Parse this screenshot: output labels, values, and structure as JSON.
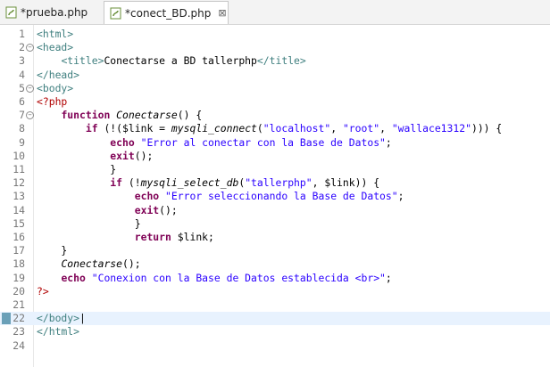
{
  "tabs": [
    {
      "label": "*prueba.php",
      "active": false
    },
    {
      "label": "*conect_BD.php",
      "active": true,
      "close": "⊠"
    }
  ],
  "lines": [
    {
      "n": "1",
      "fold": "",
      "html": "<span class='tag'>&lt;html&gt;</span>"
    },
    {
      "n": "2",
      "fold": "⊖",
      "html": "<span class='tag'>&lt;head&gt;</span>"
    },
    {
      "n": "3",
      "fold": "",
      "html": "    <span class='tag'>&lt;title&gt;</span>Conectarse a BD tallerphp<span class='tag'>&lt;/title&gt;</span>"
    },
    {
      "n": "4",
      "fold": "",
      "html": "<span class='tag'>&lt;/head&gt;</span>"
    },
    {
      "n": "5",
      "fold": "⊖",
      "html": "<span class='tag'>&lt;body&gt;</span>"
    },
    {
      "n": "6",
      "fold": "",
      "html": "<span class='php'>&lt;?php</span>"
    },
    {
      "n": "7",
      "fold": "⊖",
      "html": "    <span class='kw'>function</span> <span class='fn'>Conectarse</span>() {"
    },
    {
      "n": "8",
      "fold": "",
      "html": "        <span class='kw'>if</span> (!(<span class='var'>$link</span> = <span class='fn'>mysqli_connect</span>(<span class='str'>\"localhost\"</span>, <span class='str'>\"root\"</span>, <span class='str'>\"wallace1312\"</span>))) {"
    },
    {
      "n": "9",
      "fold": "",
      "html": "            <span class='kw'>echo</span> <span class='str'>\"Error al conectar con la Base de Datos\"</span>;"
    },
    {
      "n": "10",
      "fold": "",
      "html": "            <span class='kw'>exit</span>();"
    },
    {
      "n": "11",
      "fold": "",
      "html": "            }"
    },
    {
      "n": "12",
      "fold": "",
      "html": "            <span class='kw'>if</span> (!<span class='fn'>mysqli_select_db</span>(<span class='str'>\"tallerphp\"</span>, <span class='var'>$link</span>)) {"
    },
    {
      "n": "13",
      "fold": "",
      "html": "                <span class='kw'>echo</span> <span class='str'>\"Error seleccionando la Base de Datos\"</span>;"
    },
    {
      "n": "14",
      "fold": "",
      "html": "                <span class='kw'>exit</span>();"
    },
    {
      "n": "15",
      "fold": "",
      "html": "                }"
    },
    {
      "n": "16",
      "fold": "",
      "html": "                <span class='kw'>return</span> <span class='var'>$link</span>;"
    },
    {
      "n": "17",
      "fold": "",
      "html": "    }"
    },
    {
      "n": "18",
      "fold": "",
      "html": "    <span class='fn'>Conectarse</span>();"
    },
    {
      "n": "19",
      "fold": "",
      "html": "    <span class='kw'>echo</span> <span class='str'>\"Conexion con la Base de Datos establecida &lt;br&gt;\"</span>;"
    },
    {
      "n": "20",
      "fold": "",
      "html": "<span class='php'>?&gt;</span>"
    },
    {
      "n": "21",
      "fold": "",
      "html": ""
    },
    {
      "n": "22",
      "fold": "",
      "html": "<span class='tag'>&lt;/body&gt;</span>|",
      "current": true
    },
    {
      "n": "23",
      "fold": "",
      "html": "<span class='tag'>&lt;/html&gt;</span>"
    },
    {
      "n": "24",
      "fold": "",
      "html": ""
    }
  ]
}
